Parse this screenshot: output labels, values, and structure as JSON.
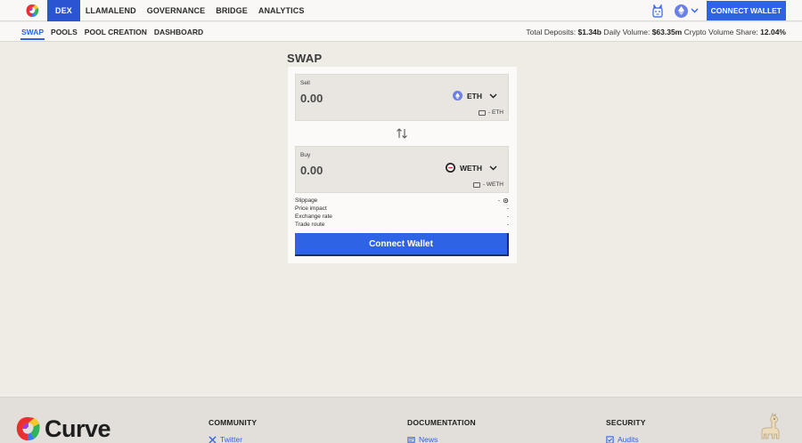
{
  "topnav": {
    "items": [
      {
        "label": "DEX",
        "active": true
      },
      {
        "label": "LLAMALEND",
        "active": false
      },
      {
        "label": "GOVERNANCE",
        "active": false
      },
      {
        "label": "BRIDGE",
        "active": false
      },
      {
        "label": "ANALYTICS",
        "active": false
      }
    ],
    "connect_label": "CONNECT WALLET",
    "theme_icon": "llama-face-icon",
    "chain_icon": "ethereum-icon"
  },
  "subnav": {
    "items": [
      {
        "label": "SWAP",
        "active": true
      },
      {
        "label": "POOLS",
        "active": false
      },
      {
        "label": "POOL CREATION",
        "active": false
      },
      {
        "label": "DASHBOARD",
        "active": false
      }
    ]
  },
  "stats": {
    "total_deposits_label": "Total Deposits:",
    "total_deposits_value": "$1.34b",
    "daily_volume_label": "Daily Volume:",
    "daily_volume_value": "$63.35m",
    "crypto_share_label": "Crypto Volume Share:",
    "crypto_share_value": "12.04%"
  },
  "swap": {
    "title": "SWAP",
    "sell": {
      "label": "Sell",
      "amount": "0.00",
      "token": "ETH",
      "balance": "- ETH"
    },
    "buy": {
      "label": "Buy",
      "amount": "0.00",
      "token": "WETH",
      "balance": "- WETH"
    },
    "details": [
      {
        "label": "Slippage",
        "value": "-"
      },
      {
        "label": "Price impact",
        "value": "-"
      },
      {
        "label": "Exchange rate",
        "value": "-"
      },
      {
        "label": "Trade route",
        "value": "-"
      }
    ],
    "connect_label": "Connect Wallet"
  },
  "footer": {
    "brand": "Curve",
    "columns": [
      {
        "heading": "COMMUNITY",
        "link": "Twitter"
      },
      {
        "heading": "DOCUMENTATION",
        "link": "News"
      },
      {
        "heading": "SECURITY",
        "link": "Audits"
      }
    ]
  },
  "colors": {
    "accent": "#2f63e6",
    "background": "#efebe5",
    "active_nav": "#2955d3"
  }
}
